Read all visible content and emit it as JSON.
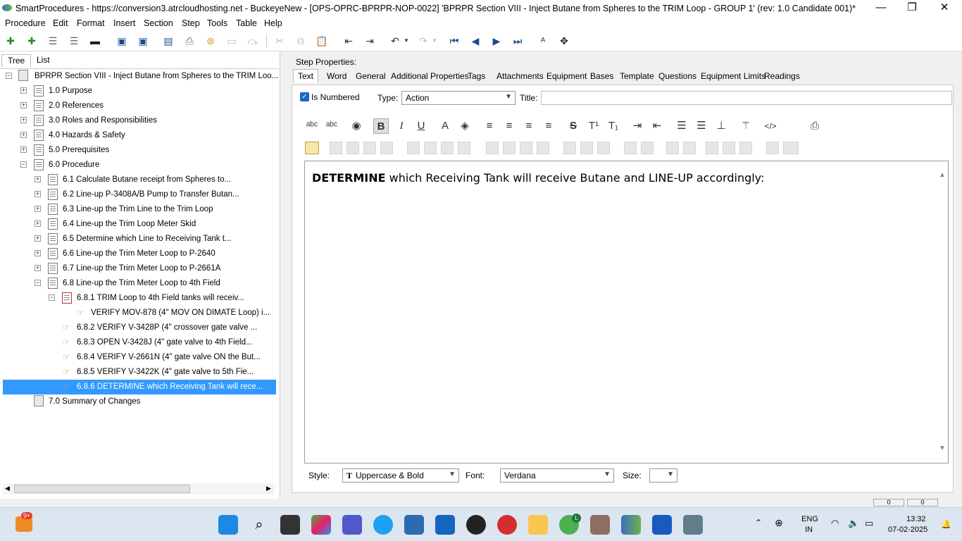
{
  "window": {
    "title": "SmartProcedures - https://conversion3.atrcloudhosting.net - BuckeyeNew - [OPS-OPRC-BPRPR-NOP-0022] 'BPRPR Section VIII - Inject Butane from Spheres to the TRIM Loop - GROUP 1' (rev: 1.0 Candidate 001)*",
    "minimize": "—",
    "restore": "❐",
    "close": "✕"
  },
  "menu": [
    "Procedure",
    "Edit",
    "Format",
    "Insert",
    "Section",
    "Step",
    "Tools",
    "Table",
    "Help"
  ],
  "left_tabs": [
    "Tree",
    "List"
  ],
  "tree": [
    {
      "label": "BPRPR Section VIII - Inject Butane from Spheres to the TRIM Loo...",
      "exp": "−"
    },
    {
      "label": "1.0 Purpose",
      "exp": "+"
    },
    {
      "label": "2.0 References",
      "exp": "+"
    },
    {
      "label": "3.0 Roles and Responsibilities",
      "exp": "+"
    },
    {
      "label": "4.0 Hazards & Safety",
      "exp": "+"
    },
    {
      "label": "5.0 Prerequisites",
      "exp": "+"
    },
    {
      "label": "6.0 Procedure",
      "exp": "−"
    },
    {
      "label": "6.1 Calculate Butane receipt from Spheres to...",
      "exp": "+"
    },
    {
      "label": "6.2 Line-up P-3408A/B Pump to Transfer Butan...",
      "exp": "+"
    },
    {
      "label": "6.3 Line-up the Trim Line to the Trim Loop",
      "exp": "+"
    },
    {
      "label": "6.4 Line-up the Trim Loop Meter Skid",
      "exp": "+"
    },
    {
      "label": "6.5 Determine which Line to Receiving Tank t...",
      "exp": "+"
    },
    {
      "label": "6.6 Line-up the Trim Meter Loop to P-2640",
      "exp": "+"
    },
    {
      "label": "6.7 Line-up the Trim Meter Loop to P-2661A",
      "exp": "+"
    },
    {
      "label": "6.8 Line-up the Trim Meter Loop to 4th Field",
      "exp": "−"
    },
    {
      "label": "6.8.1 TRIM Loop to 4th Field tanks will receiv...",
      "exp": "−"
    },
    {
      "label": "VERIFY MOV-878 (4\" MOV ON DIMATE Loop) i...",
      "exp": ""
    },
    {
      "label": "6.8.2 VERIFY V-3428P (4\" crossover gate valve ...",
      "exp": ""
    },
    {
      "label": "6.8.3 OPEN V-3428J (4\" gate valve to 4th Field...",
      "exp": ""
    },
    {
      "label": "6.8.4 VERIFY V-2661N (4\" gate valve ON the But...",
      "exp": ""
    },
    {
      "label": "6.8.5 VERIFY V-3422K (4\" gate valve to 5th Fie...",
      "exp": ""
    },
    {
      "label": "6.8.6 DETERMINE which Receiving Tank will rece...",
      "exp": ""
    },
    {
      "label": "7.0 Summary of Changes",
      "exp": ""
    }
  ],
  "step_properties": {
    "header": "Step Properties:",
    "tabs": [
      "Text",
      "Word",
      "General",
      "Additional Properties",
      "Tags",
      "Attachments",
      "Equipment",
      "Bases",
      "Template",
      "Questions",
      "Equipment Limits",
      "Readings"
    ],
    "is_numbered_label": "Is Numbered",
    "type_label": "Type:",
    "type_value": "Action",
    "title_label": "Title:",
    "title_value": ""
  },
  "editor": {
    "bold_word": "DETERMINE",
    "rest": " which Receiving Tank will receive Butane and LINE-UP accordingly:"
  },
  "footer": {
    "style_label": "Style:",
    "style_value": "Uppercase & Bold",
    "style_icon": "T",
    "font_label": "Font:",
    "font_value": "Verdana",
    "size_label": "Size:",
    "size_value": ""
  },
  "statusbar": {
    "pos1": "0",
    "pos2": "0"
  },
  "taskbar": {
    "badge": "9+",
    "lang": "ENG",
    "region": "IN",
    "time": "13:32",
    "date": "07-02-2025",
    "chrome_badge": "L"
  },
  "colors": {
    "selection": "#3399ff",
    "accent": "#1a4d8f"
  }
}
